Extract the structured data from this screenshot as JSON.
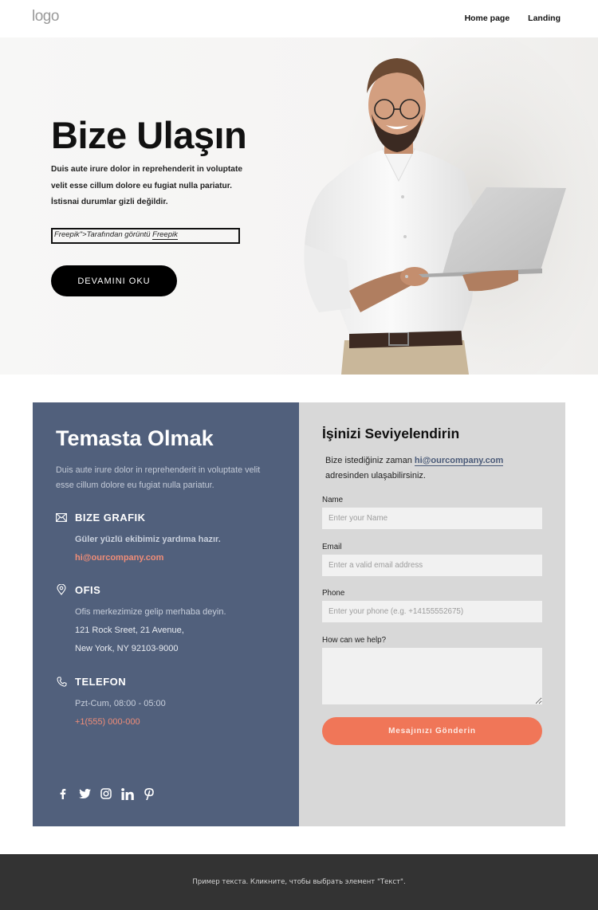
{
  "header": {
    "logo": "logo",
    "nav": [
      {
        "label": "Home page"
      },
      {
        "label": "Landing"
      }
    ]
  },
  "hero": {
    "title": "Bize Ulaşın",
    "text_lines": [
      "Duis aute irure dolor in reprehenderit in voluptate",
      "velit esse cillum dolore eu fugiat nulla pariatur.",
      "İstisnai durumlar gizli değildir."
    ],
    "credit_prefix": "Freepik\">Tarafından görüntü ",
    "credit_link": "Freepik",
    "button_label": "DEVAMINI OKU",
    "image_alt": "Smiling man in white shirt holding a laptop"
  },
  "contact_info": {
    "title": "Temasta Olmak",
    "description": "Duis aute irure dolor in reprehenderit in voluptate velit esse cillum dolore eu fugiat nulla pariatur.",
    "sections": [
      {
        "icon": "envelope-icon",
        "heading": "BIZE GRAFIK",
        "lines": [
          "Güler yüzlü ekibimiz yardıma hazır.",
          "hi@ourcompany.com"
        ]
      },
      {
        "icon": "map-pin-icon",
        "heading": "OFIS",
        "lines": [
          "Ofis merkezimize gelip merhaba deyin.",
          "121 Rock Sreet, 21 Avenue,",
          "New York, NY 92103-9000"
        ]
      },
      {
        "icon": "phone-icon",
        "heading": "TELEFON",
        "lines": [
          "Pzt-Cum, 08:00 - 05:00",
          "+1(555) 000-000"
        ]
      }
    ],
    "social": [
      "facebook-icon",
      "twitter-icon",
      "instagram-icon",
      "linkedin-icon",
      "pinterest-icon"
    ]
  },
  "form": {
    "title": "İşinizi Seviyelendirin",
    "intro_prefix": "Bize istediğiniz zaman ",
    "intro_email": "hi@ourcompany.com",
    "intro_suffix": "adresinden ulaşabilirsiniz.",
    "fields": [
      {
        "label": "Name",
        "placeholder": "Enter your Name",
        "value": ""
      },
      {
        "label": "Email",
        "placeholder": "Enter a valid email address",
        "value": ""
      },
      {
        "label": "Phone",
        "placeholder": "Enter your phone (e.g. +14155552675)",
        "value": ""
      },
      {
        "label": "How can we help?",
        "placeholder": "",
        "value": ""
      }
    ],
    "submit_label": "Mesajınızı Gönderin"
  },
  "footer": {
    "text": "Пример текста. Кликните, чтобы выбрать элемент \"Текст\"."
  },
  "colors": {
    "card_left_bg": "#51607c",
    "card_right_bg": "#d8d8d8",
    "accent": "#f07658",
    "link_accent": "#f08d78",
    "footer_bg": "#333333"
  }
}
